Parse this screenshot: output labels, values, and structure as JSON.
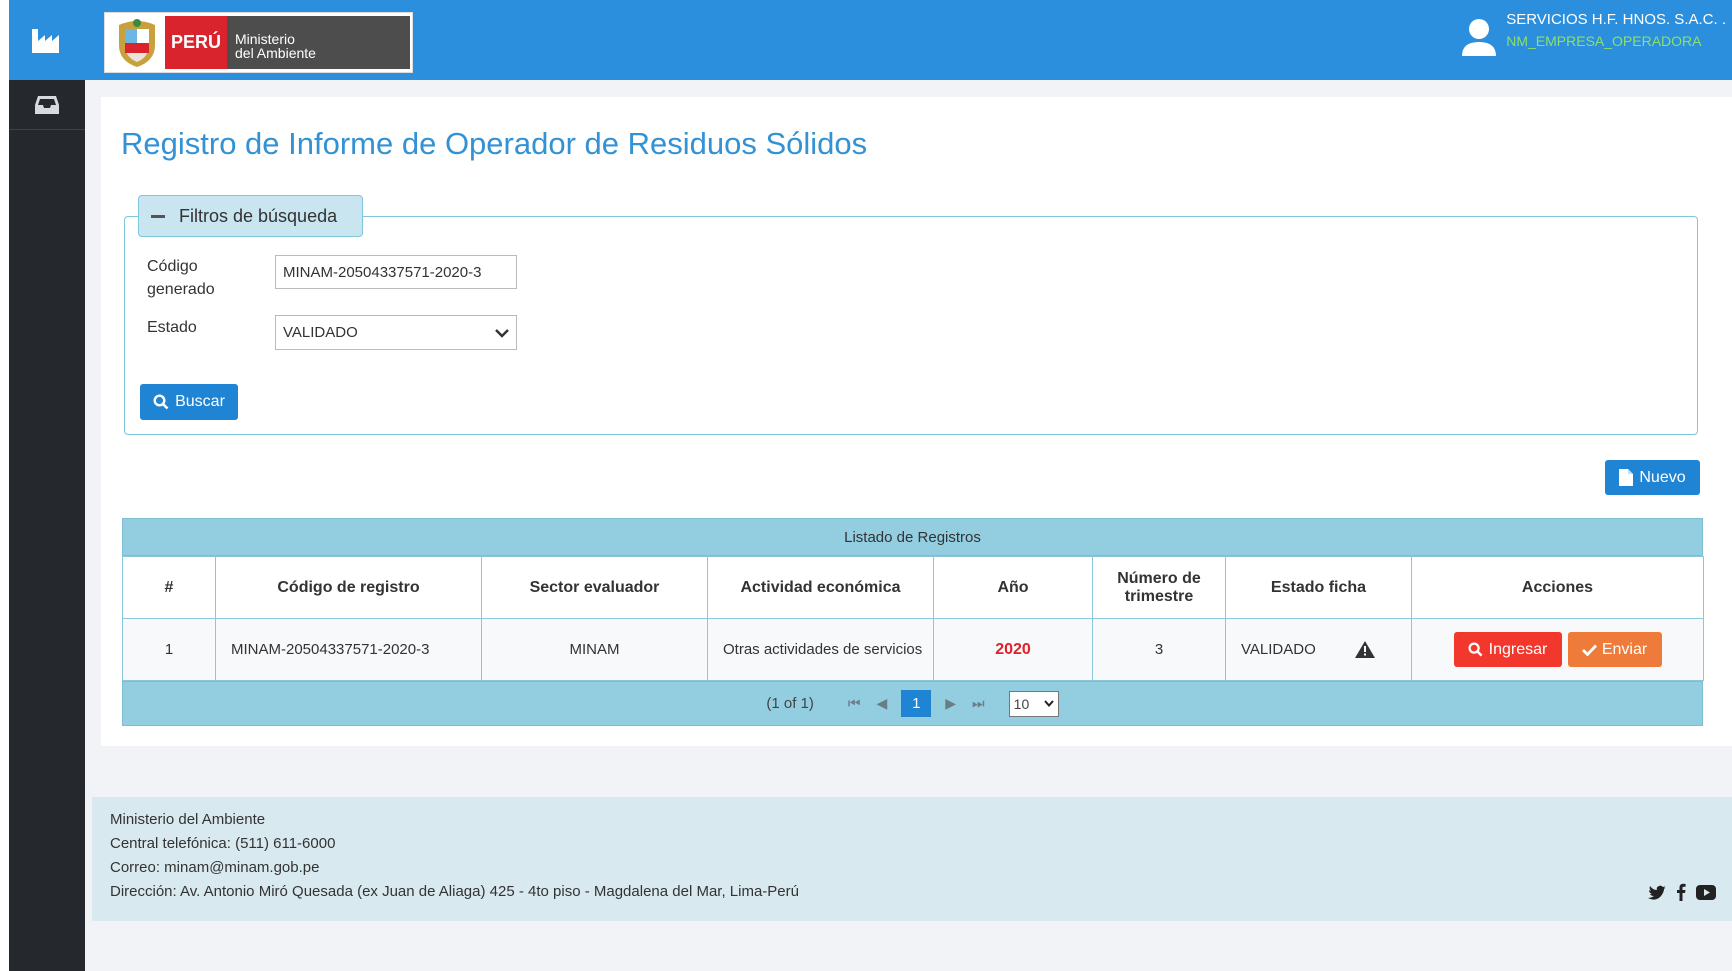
{
  "header": {
    "brand_country": "PERÚ",
    "brand_ministry_line1": "Ministerio",
    "brand_ministry_line2": "del Ambiente",
    "user_name": "SERVICIOS H.F. HNOS. S.A.C. .",
    "user_role": "NM_EMPRESA_OPERADORA"
  },
  "page": {
    "title": "Registro de Informe de Operador de Residuos Sólidos"
  },
  "filters": {
    "legend": "Filtros de búsqueda",
    "code_label_line1": "Código",
    "code_label_line2": "generado",
    "code_value": "MINAM-20504337571-2020-3",
    "estado_label": "Estado",
    "estado_value": "VALIDADO",
    "search_button": "Buscar"
  },
  "new_button": "Nuevo",
  "table": {
    "caption": "Listado de Registros",
    "columns": [
      "#",
      "Código de registro",
      "Sector evaluador",
      "Actividad económica",
      "Año",
      "Número de trimestre",
      "Estado ficha",
      "Acciones"
    ],
    "rows": [
      {
        "num": "1",
        "codigo": "MINAM-20504337571-2020-3",
        "sector": "MINAM",
        "actividad": "Otras actividades de servicios",
        "anio": "2020",
        "trimestre": "3",
        "estado": "VALIDADO",
        "btn_ingresar": "Ingresar",
        "btn_enviar": "Enviar"
      }
    ],
    "pager": {
      "summary": "(1 of 1)",
      "current_page": "1",
      "page_size": "10"
    }
  },
  "footer": {
    "org": "Ministerio del Ambiente",
    "phone": "Central telefónica: (511) 611-6000",
    "email": "Correo: minam@minam.gob.pe",
    "address": "Dirección: Av. Antonio Miró Quesada (ex Juan de Aliaga) 425 - 4to piso - Magdalena del Mar, Lima-Perú"
  },
  "colors": {
    "primary": "#2b8fdd",
    "sidebar": "#25292d",
    "danger": "#f2372c",
    "warning": "#ef7b3a",
    "table_header": "#92cde0"
  }
}
